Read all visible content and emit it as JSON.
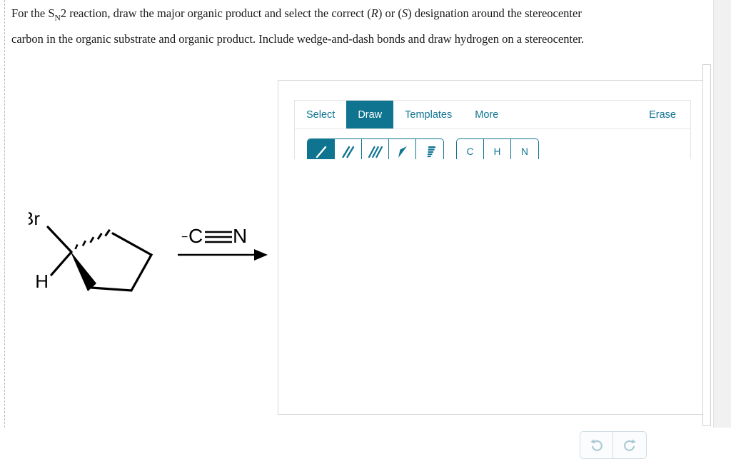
{
  "prompt": {
    "line1_a": "For the S",
    "line1_sub": "N",
    "line1_b": "2 reaction, draw the major organic product and select the correct (",
    "line1_r": "R",
    "line1_c": ") or (",
    "line1_s": "S",
    "line1_d": ") designation around the stereocenter",
    "line2": "carbon in the organic substrate and organic product. Include wedge-and-dash bonds and draw hydrogen on a stereocenter."
  },
  "editor": {
    "tabs": [
      {
        "label": "Select",
        "active": false
      },
      {
        "label": "Draw",
        "active": true
      },
      {
        "label": "Templates",
        "active": false
      },
      {
        "label": "More",
        "active": false
      }
    ],
    "erase_label": "Erase",
    "bond_tools": [
      {
        "name": "single-bond-tool",
        "selected": true
      },
      {
        "name": "double-bond-tool",
        "selected": false
      },
      {
        "name": "triple-bond-tool",
        "selected": false
      },
      {
        "name": "wedge-bond-tool",
        "selected": false
      },
      {
        "name": "hash-bond-tool",
        "selected": false
      }
    ],
    "element_tools": [
      {
        "label": "C"
      },
      {
        "label": "H"
      },
      {
        "label": "N"
      }
    ],
    "history_controls": [
      {
        "name": "undo-button",
        "icon": "undo-icon",
        "enabled": false
      },
      {
        "name": "redo-button",
        "icon": "redo-icon",
        "enabled": false
      }
    ],
    "zoom_controls": [
      {
        "name": "zoom-in-button",
        "icon": "zoom-in-icon"
      },
      {
        "name": "zoom-reset-button",
        "icon": "zoom-reset-icon"
      },
      {
        "name": "zoom-out-button",
        "icon": "zoom-out-icon"
      }
    ],
    "canvas_empty": true
  },
  "reaction": {
    "substrate": {
      "name": "bromocyclopentane-stereocenter",
      "labels": {
        "halogen": "Br",
        "hydrogen": "H"
      },
      "ring": "cyclopentane",
      "bonds": {
        "hash": "hashed-bond-up-right",
        "wedge": "wedge-bond-down-right"
      }
    },
    "reagent": {
      "charge": "−",
      "atom1": "C",
      "atom2": "N",
      "bond": "triple"
    },
    "arrow": "reaction-arrow-right"
  },
  "colors": {
    "teal": "#0f7490",
    "disabled_icon": "#a8c8d4",
    "panel_border": "#d6d6d6",
    "text": "#1a1a1a"
  }
}
